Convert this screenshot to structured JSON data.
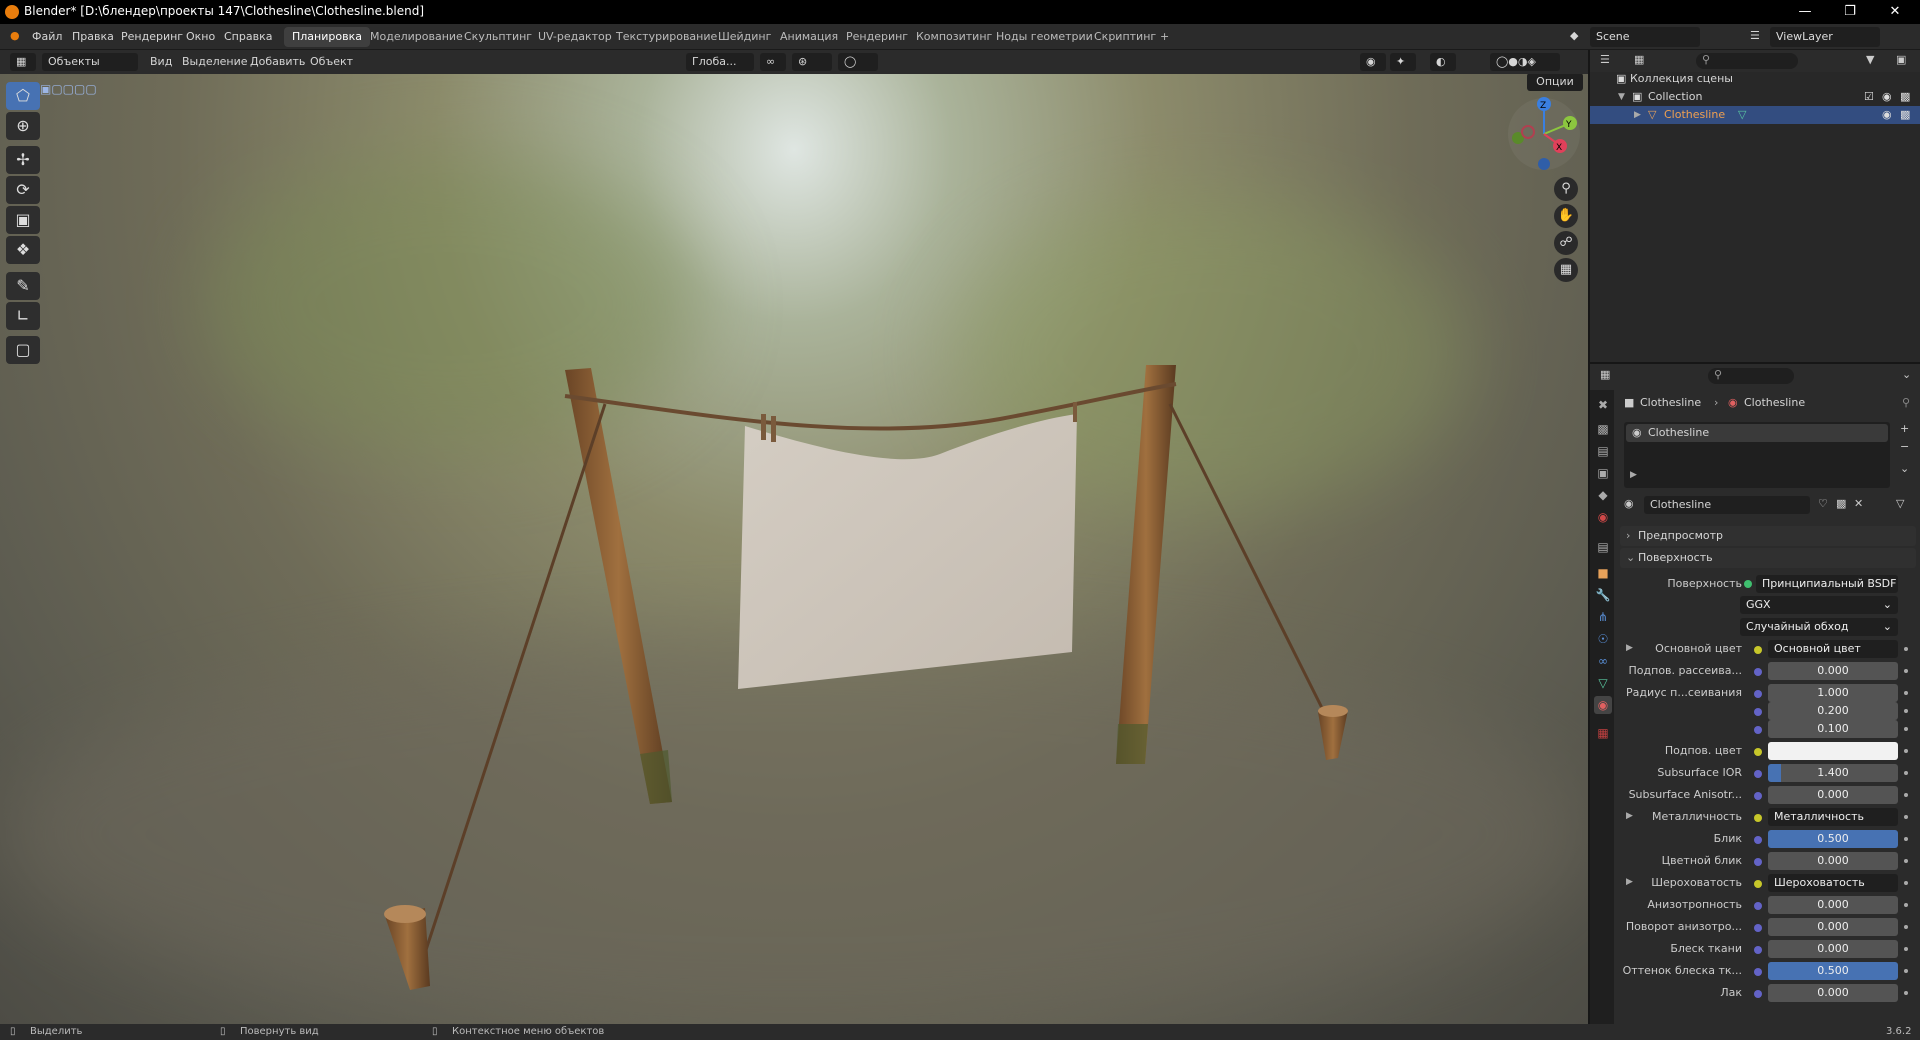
{
  "app": {
    "title": "Blender* [D:\\блендер\\проекты 147\\Clothesline\\Clothesline.blend]",
    "version": "3.6.2"
  },
  "menus": [
    "Файл",
    "Правка",
    "Рендеринг",
    "Окно",
    "Справка"
  ],
  "workspaces": [
    "Планировка",
    "Моделирование",
    "Скульптинг",
    "UV-редактор",
    "Текстурирование",
    "Шейдинг",
    "Анимация",
    "Рендеринг",
    "Композитинг",
    "Ноды геометрии",
    "Скриптинг",
    "+"
  ],
  "active_workspace": "Планировка",
  "scene": "Scene",
  "view_layer": "ViewLayer",
  "viewport_header": {
    "mode": "Объекты",
    "view": "Вид",
    "select": "Выделение",
    "add": "Добавить",
    "object": "Объект",
    "transform": "Глоба...",
    "options": "Опции"
  },
  "outliner": {
    "root": "Коллекция сцены",
    "collection": "Collection",
    "object": "Clothesline"
  },
  "properties": {
    "breadcrumb_object": "Clothesline",
    "breadcrumb_material": "Clothesline",
    "material_slot": "Clothesline",
    "material_name": "Clothesline",
    "panel_preview": "Предпросмотр",
    "panel_surface": "Поверхность",
    "surface_label": "Поверхность",
    "surface_value": "Принципиальный BSDF",
    "distribution": "GGX",
    "subsurface_method": "Случайный обход",
    "rows": [
      {
        "label": "Основной цвет",
        "value": "Основной цвет",
        "type": "link"
      },
      {
        "label": "Подпов. рассеива...",
        "value": "0.000",
        "type": "num"
      },
      {
        "label": "Радиус п...сеивания",
        "value": "1.000",
        "type": "num"
      },
      {
        "label": "",
        "value": "0.200",
        "type": "num"
      },
      {
        "label": "",
        "value": "0.100",
        "type": "num"
      },
      {
        "label": "Подпов. цвет",
        "value": "",
        "type": "color"
      },
      {
        "label": "Subsurface IOR",
        "value": "1.400",
        "type": "num"
      },
      {
        "label": "Subsurface Anisotr...",
        "value": "0.000",
        "type": "num"
      },
      {
        "label": "Металличность",
        "value": "Металличность",
        "type": "link"
      },
      {
        "label": "Блик",
        "value": "0.500",
        "type": "blue"
      },
      {
        "label": "Цветной блик",
        "value": "0.000",
        "type": "num"
      },
      {
        "label": "Шероховатость",
        "value": "Шероховатость",
        "type": "link"
      },
      {
        "label": "Анизотропность",
        "value": "0.000",
        "type": "num"
      },
      {
        "label": "Поворот анизотро...",
        "value": "0.000",
        "type": "num"
      },
      {
        "label": "Блеск ткани",
        "value": "0.000",
        "type": "num"
      },
      {
        "label": "Оттенок блеска тк...",
        "value": "0.500",
        "type": "blue"
      },
      {
        "label": "Лак",
        "value": "0.000",
        "type": "num"
      }
    ]
  },
  "statusbar": {
    "select": "Выделить",
    "rotate": "Повернуть вид",
    "context": "Контекстное меню объектов"
  },
  "colors": {
    "accent": "#4772b3",
    "blender_orange": "#e87d0d"
  }
}
